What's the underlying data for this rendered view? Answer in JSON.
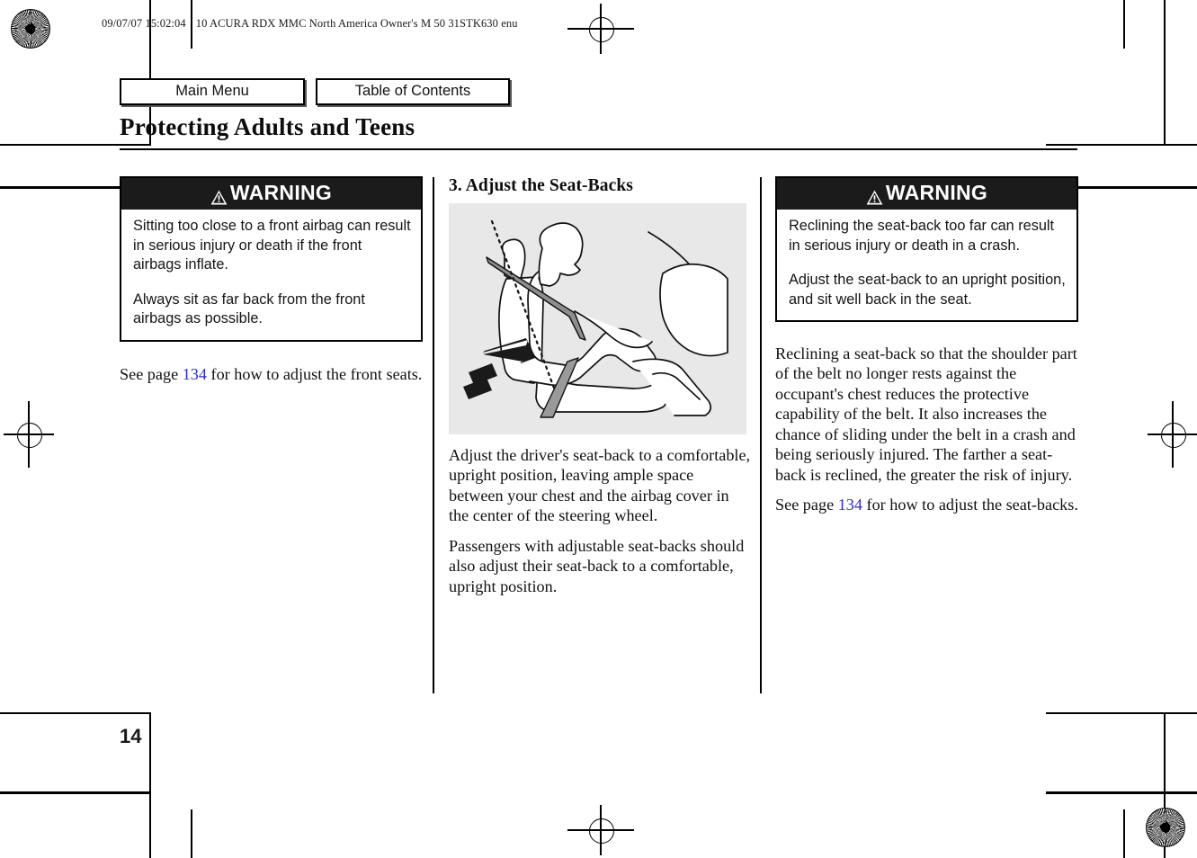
{
  "print_slug": {
    "timestamp": "09/07/07 15:02:04",
    "job": "10 ACURA RDX MMC North America Owner's M 50 31STK630 enu"
  },
  "nav": {
    "main_menu_label": "Main Menu",
    "table_of_contents_label": "Table of Contents"
  },
  "header": {
    "title": "Protecting Adults and Teens"
  },
  "left_column": {
    "warning": {
      "heading": "WARNING",
      "paragraphs": [
        "Sitting too close to a front airbag can result in serious injury or death if the front airbags inflate.",
        "Always sit as far back from the front airbags as possible."
      ]
    },
    "see_page": {
      "prefix": "See page ",
      "page_number": "134",
      "suffix": " for how to adjust the front seats."
    }
  },
  "middle_column": {
    "section_heading": "3. Adjust the Seat-Backs",
    "figure_name": "driver-seat-back-adjustment-illustration",
    "paragraphs": [
      "Adjust the driver's seat-back to a comfortable, upright position, leaving ample space between your chest and the airbag cover in the center of the steering wheel.",
      "Passengers with adjustable seat-backs should also adjust their seat-back to a comfortable, upright position."
    ]
  },
  "right_column": {
    "warning": {
      "heading": "WARNING",
      "paragraphs": [
        "Reclining the seat-back too far can result in serious injury or death in a crash.",
        "Adjust the seat-back to an upright position, and sit well back in the seat."
      ]
    },
    "body_paragraph": "Reclining a seat-back so that the shoulder part of the belt no longer rests against the occupant's chest reduces the protective capability of the belt. It also increases the chance of sliding under the belt in a crash and being seriously injured. The farther a seat-back is reclined, the greater the risk of injury.",
    "see_page": {
      "prefix": "See page ",
      "page_number": "134",
      "suffix": " for how to adjust the seat-backs."
    }
  },
  "footer": {
    "page_number": "14"
  },
  "colors": {
    "link": "#2b2bd8",
    "warning_bar": "#1b1b1b",
    "figure_background": "#e8e8e8"
  }
}
